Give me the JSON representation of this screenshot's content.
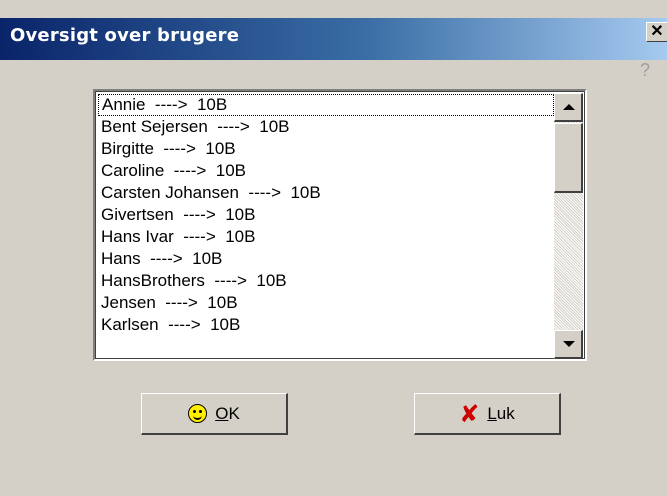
{
  "window": {
    "title": "Oversigt over brugere",
    "close_glyph": "✕",
    "help_glyph": "?"
  },
  "list": {
    "items": [
      "Annie  ---->  10B",
      "Bent Sejersen  ---->  10B",
      "Birgitte  ---->  10B",
      "Caroline  ---->  10B",
      "Carsten Johansen  ---->  10B",
      "Givertsen  ---->  10B",
      "Hans Ivar  ---->  10B",
      "Hans  ---->  10B",
      "HansBrothers  ---->  10B",
      "Jensen  ---->  10B",
      "Karlsen  ---->  10B"
    ],
    "focused_index": 0
  },
  "buttons": {
    "ok": {
      "accel": "O",
      "rest": "K",
      "icon": "smiley-icon"
    },
    "luk": {
      "accel": "L",
      "rest": "uk",
      "icon": "red-x-icon"
    }
  },
  "colors": {
    "title_start": "#0a246a",
    "title_end": "#a6caf0",
    "face": "#d4d0c8"
  }
}
